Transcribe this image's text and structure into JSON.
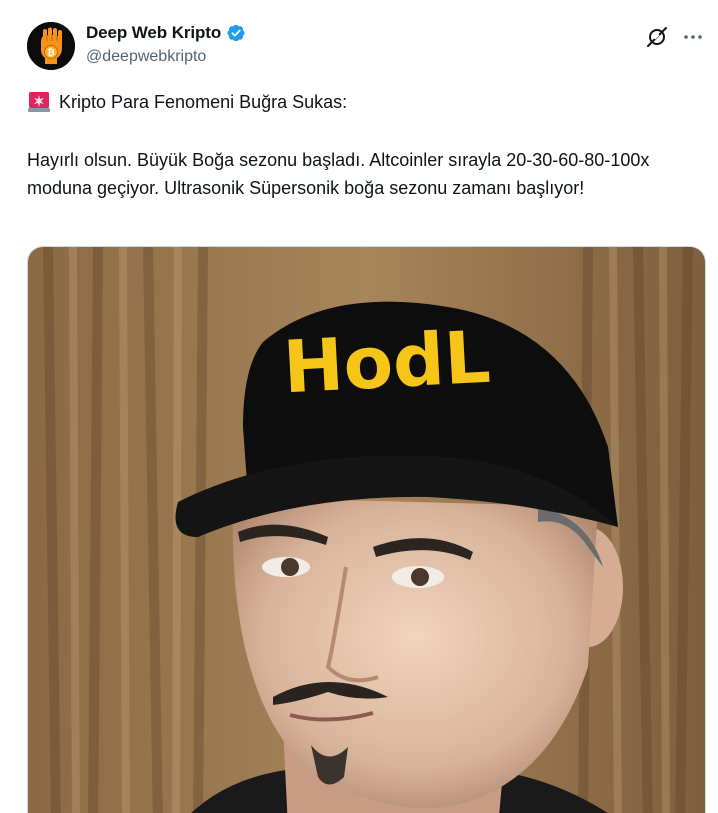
{
  "author": {
    "display_name": "Deep Web Kripto",
    "handle": "@deepwebkripto",
    "verified": true,
    "avatar_icon": "fist-bitcoin-icon"
  },
  "actions": {
    "grok_icon": "grok-icon",
    "more_icon": "more-icon"
  },
  "tweet": {
    "headline_emoji": "rotating-light-icon",
    "headline": "Kripto Para Fenomeni Buğra Sukas:",
    "body": "Hayırlı olsun. Büyük Boğa sezonu başladı. Altcoinler sırayla 20-30-60-80-100x moduna geçiyor. Ultrasonik Süpersonik boğa sezonu zamanı başlıyor!"
  },
  "media": {
    "cap_text": "HodL"
  },
  "colors": {
    "verified_blue": "#1d9bf0",
    "handle_gray": "#536471",
    "avatar_orange": "#f7931a",
    "cap_yellow": "#f5c518"
  }
}
